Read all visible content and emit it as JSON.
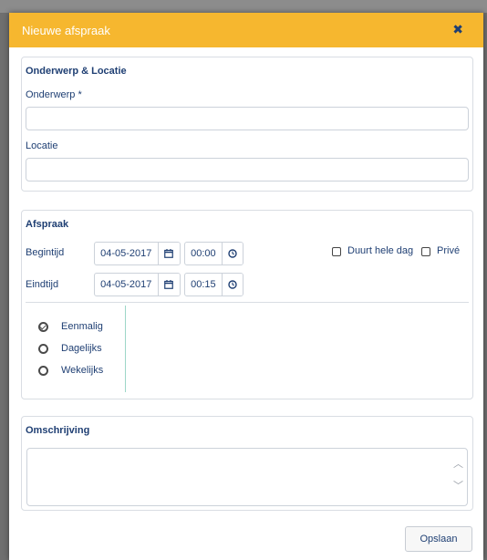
{
  "dialog": {
    "title": "Nieuwe afspraak",
    "close_icon": "close-icon"
  },
  "subject_location": {
    "section_title": "Onderwerp & Locatie",
    "subject_label": "Onderwerp *",
    "subject_value": "",
    "location_label": "Locatie",
    "location_value": ""
  },
  "appointment": {
    "section_title": "Afspraak",
    "start_label": "Begintijd",
    "start_date": "04-05-2017",
    "start_time": "00:00",
    "end_label": "Eindtijd",
    "end_date": "04-05-2017",
    "end_time": "00:15",
    "all_day_label": "Duurt hele dag",
    "all_day_checked": false,
    "private_label": "Privé",
    "private_checked": false,
    "recurrence": [
      {
        "label": "Eenmalig",
        "checked": true
      },
      {
        "label": "Dagelijks",
        "checked": false
      },
      {
        "label": "Wekelijks",
        "checked": false
      }
    ]
  },
  "description": {
    "section_title": "Omschrijving",
    "value": ""
  },
  "footer": {
    "save_label": "Opslaan"
  },
  "colors": {
    "titlebar": "#f6b72f",
    "text": "#1f3f73"
  }
}
